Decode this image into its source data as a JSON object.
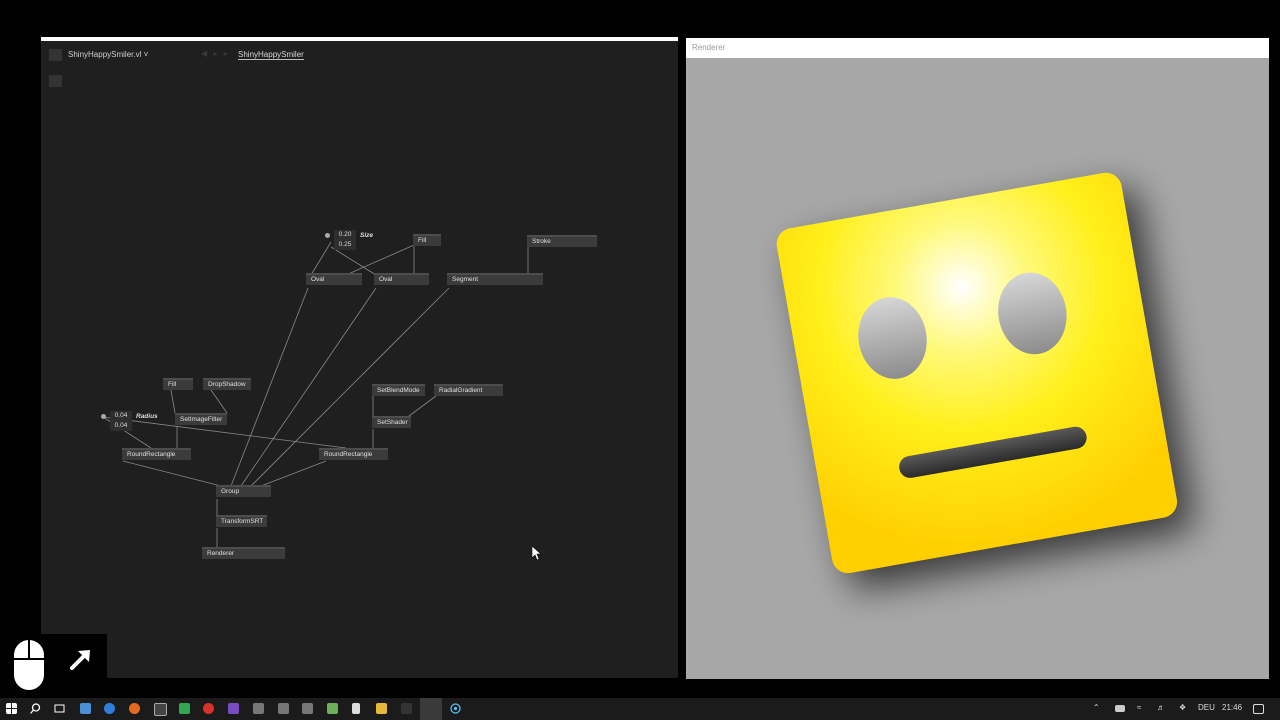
{
  "editor": {
    "document_name": "ShinyHappySmiler.vl ˅",
    "nav_arrows": "◀ ▸ ▸",
    "patch_name": "ShinyHappySmiler",
    "nodes": {
      "fill_top": "Fill",
      "stroke": "Stroke",
      "oval_1": "Oval",
      "oval_2": "Oval",
      "segment": "Segment",
      "fill_left": "Fill",
      "dropshadow": "DropShadow",
      "setimagefilter": "SetImageFilter",
      "setblendmode": "SetBlendMode",
      "radialgradient": "RadialGradient",
      "setshader": "SetShader",
      "roundrect_1": "RoundRectangle",
      "roundrect_2": "RoundRectangle",
      "group": "Group",
      "transformsrt": "TransformSRT",
      "renderer": "Renderer"
    },
    "iobox_size": {
      "v1": "0.20",
      "v2": "0.25",
      "label": "Size"
    },
    "iobox_radius": {
      "v1": "0.04",
      "v2": "0.04",
      "label": "Radius"
    }
  },
  "renderer": {
    "title": "Renderer"
  },
  "colors": {
    "editor_bg": "#1f1f1f",
    "node_bg": "#3b3b3b",
    "renderer_bg": "#a7a7a7",
    "smiley_yellow": "#ffe600",
    "taskbar_bg": "#1b1b1b"
  },
  "taskbar": {
    "language": "DEU",
    "time": "21:46",
    "icons": [
      "windows-icon",
      "search-icon",
      "task-view-icon",
      "file-explorer-icon",
      "edge-icon",
      "firefox-icon",
      "terminal-icon",
      "excel-icon",
      "pdf-icon",
      "visual-studio-icon",
      "app-icon",
      "app-icon",
      "app-icon",
      "notepad-icon",
      "calculator-icon",
      "folder-icon",
      "app-icon",
      "vvvv-icon",
      "renderer-icon"
    ]
  }
}
